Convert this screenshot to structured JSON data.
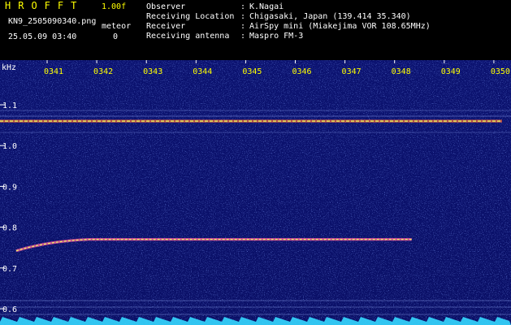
{
  "header": {
    "app_title": "HROFFT",
    "version": "1.00f",
    "filename": "KN9_2505090340.png",
    "datetime": "25.05.09 03:40",
    "meteor_label": "meteor",
    "meteor_count": "0",
    "info": [
      {
        "label": "Observer",
        "value": "K.Nagai"
      },
      {
        "label": "Receiving Location",
        "value": "Chigasaki, Japan (139.414 35.340)"
      },
      {
        "label": "Receiver",
        "value": "AirSpy mini (Miakejima VOR 108.65MHz)"
      },
      {
        "label": "Receiving antenna",
        "value": "Maspro FM-3"
      }
    ]
  },
  "chart_data": {
    "type": "heatmap",
    "ylabel": "kHz",
    "yticks": [
      "1.1",
      "1.0",
      "0.9",
      "0.8",
      "0.7",
      "0.6"
    ],
    "xticks": [
      "0341",
      "0342",
      "0343",
      "0344",
      "0345",
      "0346",
      "0347",
      "0348",
      "0349",
      "0350"
    ],
    "colors": {
      "background": "#0a0f6e",
      "noise": "#4a6cff",
      "signal": "#e8ff60",
      "tick": "#ffff00"
    },
    "signals": [
      {
        "freq_khz": 1.06,
        "start_min": 0,
        "end_min": 10
      },
      {
        "freq_khz": 0.77,
        "start_min": 0,
        "end_min": 8.2
      }
    ]
  }
}
